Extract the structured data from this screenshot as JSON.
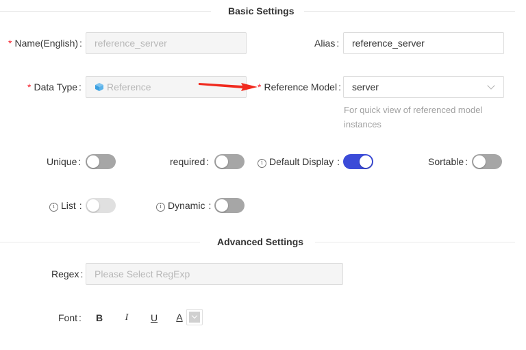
{
  "basic": {
    "title": "Basic Settings",
    "name_label": "Name(English)",
    "name_value": "reference_server",
    "alias_label": "Alias",
    "alias_value": "reference_server",
    "datatype_label": "Data Type",
    "datatype_value": "Reference",
    "datatype_icon": "cube-icon",
    "refmodel_label": "Reference Model",
    "refmodel_value": "server",
    "refmodel_hint": "For quick view of referenced model instances",
    "colon": ":",
    "required_mark": "*"
  },
  "switches": {
    "unique": {
      "label": "Unique",
      "state": "off"
    },
    "required": {
      "label": "required",
      "state": "off"
    },
    "default_display": {
      "label": "Default Display",
      "state": "on"
    },
    "sortable": {
      "label": "Sortable",
      "state": "off"
    },
    "list": {
      "label": "List",
      "state": "disabled"
    },
    "dynamic": {
      "label": "Dynamic",
      "state": "off"
    }
  },
  "advanced": {
    "title": "Advanced Settings",
    "regex_label": "Regex",
    "regex_placeholder": "Please Select RegExp",
    "font_label": "Font",
    "bold": "B",
    "italic": "I",
    "underline": "U",
    "color": "A"
  },
  "colors": {
    "accent": "#3b4bd8",
    "required": "#f5222d",
    "annotation_arrow": "#f02a1e"
  }
}
